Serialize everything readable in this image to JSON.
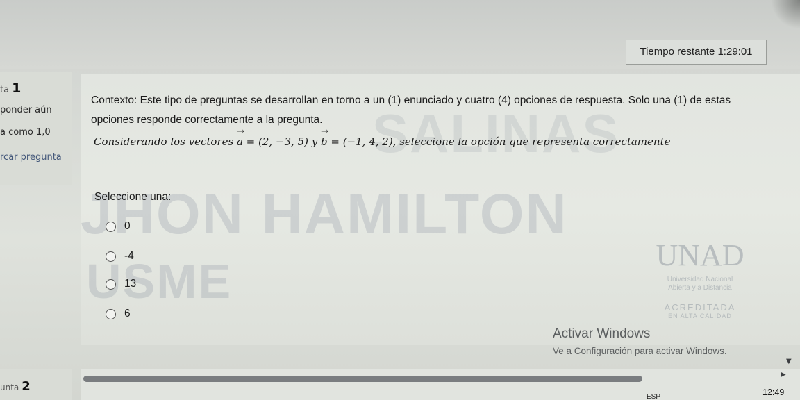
{
  "timer": {
    "label": "Tiempo restante",
    "value": "1:29:01"
  },
  "question_info": {
    "prefix": "ta",
    "number": "1",
    "status": "ponder aún",
    "score": "a como 1,0",
    "flag": "rcar pregunta"
  },
  "question": {
    "context": "Contexto: Este tipo de preguntas se desarrollan en torno a un (1) enunciado y cuatro (4) opciones de respuesta. Solo una (1) de estas opciones responde correctamente a la pregunta.",
    "statement_before": "Considerando los vectores ",
    "vec_a": "a",
    "vec_a_value": " = (2, −3, 5) y ",
    "vec_b": "b",
    "vec_b_value": " = (−1, 4, 2), ",
    "statement_after": "seleccione la opción que representa correctamente",
    "select_label": "Seleccione una:",
    "options": [
      "0",
      "-4",
      "13",
      "6"
    ]
  },
  "watermarks": {
    "line1": "JHON HAMILTON",
    "line2": "USME",
    "line3": "SALINAS"
  },
  "logo": {
    "mark": "UNAD",
    "sub1": "Universidad Nacional",
    "sub2": "Abierta y a Distancia",
    "accredited": "ACREDITADA",
    "quality": "EN ALTA CALIDAD"
  },
  "windows_activation": {
    "title": "Activar Windows",
    "subtitle": "Ve a Configuración para activar Windows."
  },
  "next_question": {
    "prefix": "unta",
    "number": "2"
  },
  "taskbar": {
    "language": "ESP",
    "clock": "12:49"
  },
  "icons": {
    "scroll_right": "triangle-right-icon",
    "scroll_down": "triangle-down-icon"
  },
  "colors": {
    "panel_bg": "#e2e5e0",
    "text": "#1c1c1c",
    "link": "#44587a",
    "scrollbar": "#7a7d80"
  }
}
